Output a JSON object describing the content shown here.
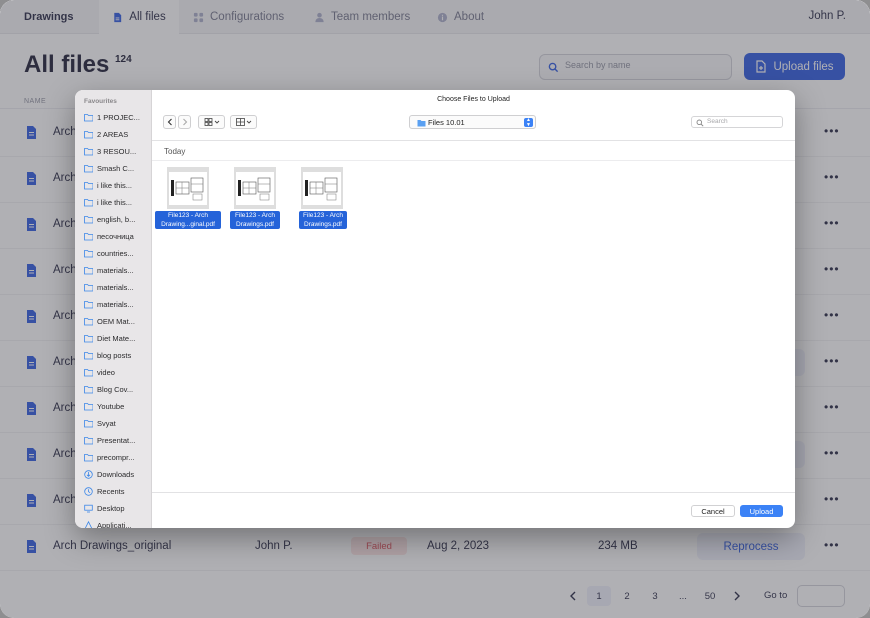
{
  "app": {
    "brand": "Drawings",
    "nav": [
      {
        "label": "All files",
        "active": true,
        "icon": "file-icon"
      },
      {
        "label": "Configurations",
        "active": false,
        "icon": "grid-icon"
      },
      {
        "label": "Team members",
        "active": false,
        "icon": "person-icon"
      },
      {
        "label": "About",
        "active": false,
        "icon": "info-icon"
      }
    ],
    "user": "John P."
  },
  "header": {
    "title": "All files",
    "count": "124",
    "search_placeholder": "Search by name",
    "upload_label": "Upload files",
    "column_name": "NAME"
  },
  "rows": [
    {
      "name": "Arch"
    },
    {
      "name": "Arch"
    },
    {
      "name": "Arch"
    },
    {
      "name": "Arch"
    },
    {
      "name": "Arch"
    },
    {
      "name": "Arch"
    },
    {
      "name": "Arch"
    },
    {
      "name": "Arch"
    },
    {
      "name": "Arch"
    },
    {
      "name": "Arch Drawings_original",
      "owner": "John P.",
      "status": "Failed",
      "date": "Aug 2, 2023",
      "size": "234 MB",
      "action": "Reprocess"
    }
  ],
  "pagination": {
    "pages": [
      "1",
      "2",
      "3",
      "...",
      "50"
    ],
    "current": "1",
    "goto_label": "Go to"
  },
  "dialog": {
    "title": "Choose Files to Upload",
    "sidebar_heading": "Favourites",
    "sidebar_items": [
      {
        "label": "1 PROJEC...",
        "icon": "folder-icon"
      },
      {
        "label": "2 AREAS",
        "icon": "folder-icon"
      },
      {
        "label": "3 RESOU...",
        "icon": "folder-icon"
      },
      {
        "label": "Smash C...",
        "icon": "folder-icon"
      },
      {
        "label": "i like this...",
        "icon": "folder-icon"
      },
      {
        "label": "i like this...",
        "icon": "folder-icon"
      },
      {
        "label": "english, b...",
        "icon": "folder-icon"
      },
      {
        "label": "песочница",
        "icon": "folder-icon"
      },
      {
        "label": "countries...",
        "icon": "folder-icon"
      },
      {
        "label": "materials...",
        "icon": "folder-icon"
      },
      {
        "label": "materials...",
        "icon": "folder-icon"
      },
      {
        "label": "materials...",
        "icon": "folder-icon"
      },
      {
        "label": "OEM Mat...",
        "icon": "folder-icon"
      },
      {
        "label": "Diet Mate...",
        "icon": "folder-icon"
      },
      {
        "label": "blog posts",
        "icon": "folder-icon"
      },
      {
        "label": "video",
        "icon": "folder-icon"
      },
      {
        "label": "Blog Cov...",
        "icon": "folder-icon"
      },
      {
        "label": "Youtube",
        "icon": "folder-icon"
      },
      {
        "label": "Svyat",
        "icon": "folder-icon"
      },
      {
        "label": "Presentat...",
        "icon": "folder-icon"
      },
      {
        "label": "precompr...",
        "icon": "folder-icon"
      },
      {
        "label": "Downloads",
        "icon": "download-icon"
      },
      {
        "label": "Recents",
        "icon": "clock-icon"
      },
      {
        "label": "Desktop",
        "icon": "desktop-icon"
      },
      {
        "label": "Applicati...",
        "icon": "apps-icon"
      }
    ],
    "location": "Files 10.01",
    "search_placeholder": "Search",
    "group": "Today",
    "files": [
      {
        "line1": "File123 - Arch",
        "line2": "Drawing...ginal.pdf"
      },
      {
        "line1": "File123 - Arch",
        "line2": "Drawings.pdf"
      },
      {
        "line1": "File123 - Arch",
        "line2": "Drawings.pdf"
      }
    ],
    "cancel_label": "Cancel",
    "upload_label": "Upload"
  },
  "colors": {
    "accent": "#2352e0",
    "failed_bg": "#fde3e4",
    "failed_text": "#d9434d",
    "selection": "#2563d9"
  }
}
